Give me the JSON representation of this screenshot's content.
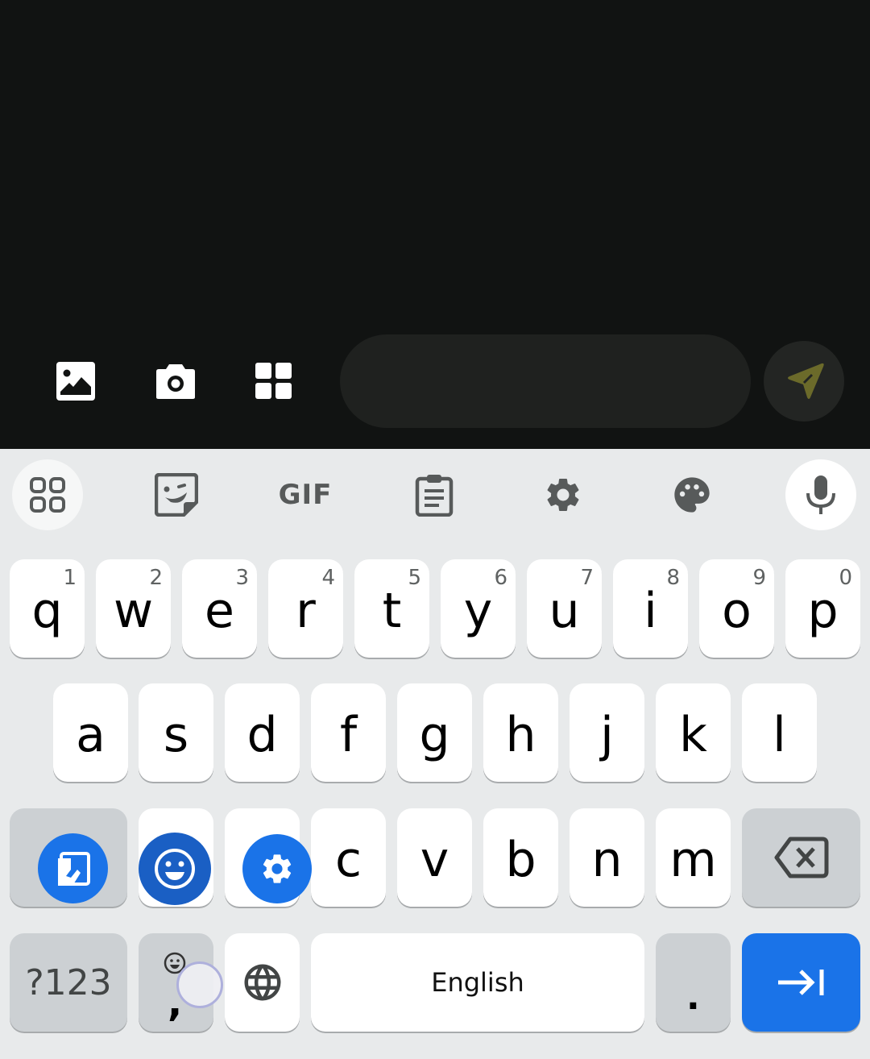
{
  "app": {
    "toolbar": {
      "gallery_icon": "image-icon",
      "camera_icon": "camera-icon",
      "apps_icon": "grid-icon"
    },
    "message_input": {
      "value": "",
      "placeholder": ""
    },
    "send_button": {
      "icon": "send-icon",
      "color": "#6b6a2a"
    }
  },
  "keyboard": {
    "toolbar": {
      "apps": "apps-grid-icon",
      "sticker": "sticker-icon",
      "gif_label": "GIF",
      "clipboard": "clipboard-icon",
      "settings": "gear-icon",
      "theme": "palette-icon",
      "voice": "microphone-icon"
    },
    "row1": [
      {
        "key": "q",
        "hint": "1"
      },
      {
        "key": "w",
        "hint": "2"
      },
      {
        "key": "e",
        "hint": "3"
      },
      {
        "key": "r",
        "hint": "4"
      },
      {
        "key": "t",
        "hint": "5"
      },
      {
        "key": "y",
        "hint": "6"
      },
      {
        "key": "u",
        "hint": "7"
      },
      {
        "key": "i",
        "hint": "8"
      },
      {
        "key": "o",
        "hint": "9"
      },
      {
        "key": "p",
        "hint": "0"
      }
    ],
    "row2": [
      "a",
      "s",
      "d",
      "f",
      "g",
      "h",
      "j",
      "k",
      "l"
    ],
    "row3": [
      "c",
      "v",
      "b",
      "n",
      "m"
    ],
    "shift_overlay": {
      "one_handed": "one-handed-mode-icon",
      "emoji": "emoji-icon",
      "settings": "gear-icon"
    },
    "backspace": "backspace-icon",
    "symbols_label": "?123",
    "comma_label": ",",
    "comma_hint": "emoji-icon",
    "language_icon": "globe-icon",
    "space_label": "English",
    "period_label": ".",
    "action_icon": "tab-next-icon",
    "accent_color": "#1a73e8"
  }
}
